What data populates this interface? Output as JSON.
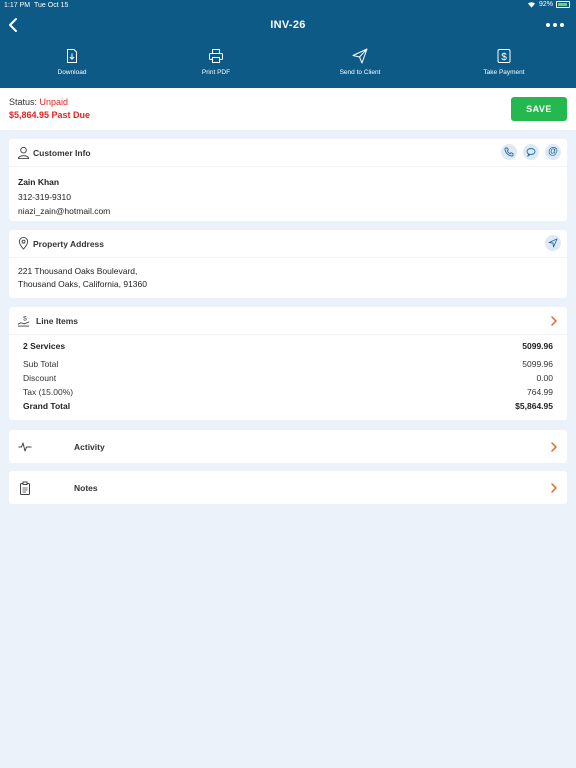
{
  "status_bar": {
    "time": "1:17 PM",
    "date": "Tue Oct 15",
    "battery": "92%"
  },
  "header": {
    "title": "INV-26"
  },
  "toolbar": [
    {
      "label": "Download",
      "icon": "download-icon"
    },
    {
      "label": "Print PDF",
      "icon": "printer-icon"
    },
    {
      "label": "Send to Client",
      "icon": "send-icon"
    },
    {
      "label": "Take Payment",
      "icon": "dollar-icon"
    }
  ],
  "invoice_status": {
    "label": "Status:",
    "value": "Unpaid",
    "past_due": "$5,864.95 Past Due",
    "save_label": "SAVE"
  },
  "customer": {
    "heading": "Customer Info",
    "name": "Zain Khan",
    "phone": "312-319-9310",
    "email": "niazi_zain@hotmail.com"
  },
  "property": {
    "heading": "Property Address",
    "line1": "221 Thousand Oaks Boulevard,",
    "line2": "Thousand Oaks, California, 91360"
  },
  "line_items": {
    "heading": "Line Items",
    "services_label": "2 Services",
    "services_value": "5099.96",
    "subtotal_label": "Sub Total",
    "subtotal_value": "5099.96",
    "discount_label": "Discount",
    "discount_value": "0.00",
    "tax_label": "Tax (15.00%)",
    "tax_value": "764.99",
    "grand_label": "Grand Total",
    "grand_value": "$5,864.95"
  },
  "activity": {
    "label": "Activity"
  },
  "notes": {
    "label": "Notes"
  },
  "colors": {
    "header": "#0d5a86",
    "accent": "#e0662b",
    "danger": "#e02424",
    "save": "#25b84e",
    "background": "#ebf2f9"
  }
}
